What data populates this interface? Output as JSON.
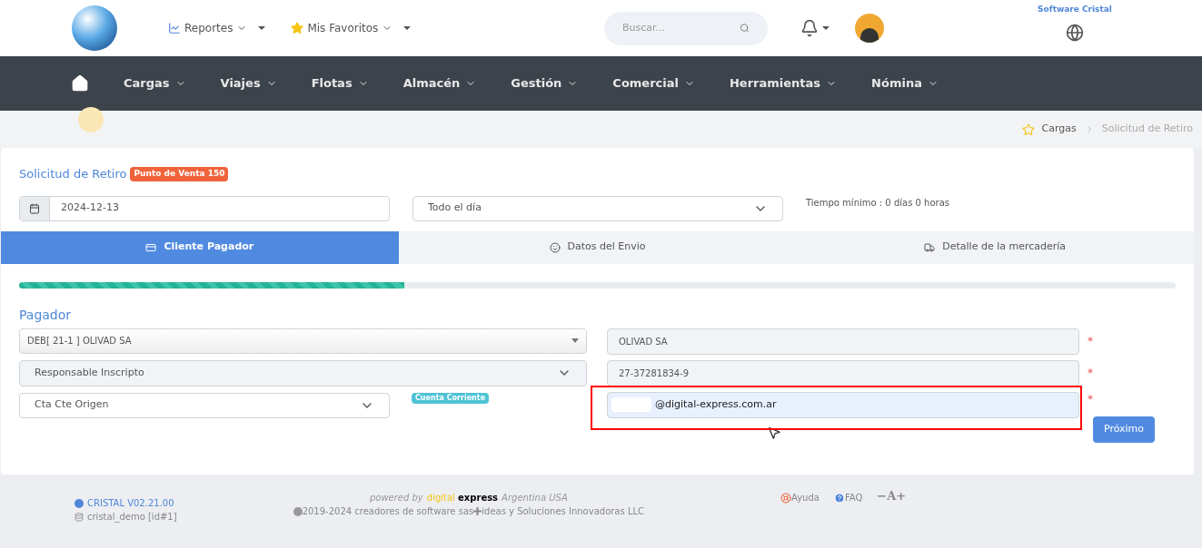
{
  "header": {
    "menus": [
      {
        "label": "Reportes",
        "kind": "chart"
      },
      {
        "label": "Mis Favoritos",
        "kind": "star"
      }
    ],
    "search": {
      "placeholder": "Buscar..."
    },
    "corner_text": "Software Cristal"
  },
  "nav": {
    "items": [
      {
        "label": "Cargas"
      },
      {
        "label": "Viajes"
      },
      {
        "label": "Flotas"
      },
      {
        "label": "Almacén"
      },
      {
        "label": "Gestión"
      },
      {
        "label": "Comercial"
      },
      {
        "label": "Herramientas"
      },
      {
        "label": "Nómina"
      }
    ]
  },
  "breadcrumb": [
    "Cargas",
    "Solicitud de Retiro"
  ],
  "form": {
    "title": "Solicitud de Retiro",
    "badge": "Punto de Venta 150",
    "date": "2024-12-13",
    "time_option": "Todo el día",
    "min_time": "Tiempo mínimo : 0 días 0 horas",
    "tabs": [
      {
        "label": "Cliente Pagador",
        "selected": true,
        "kind": "card"
      },
      {
        "label": "Datos del Envio",
        "selected": false,
        "kind": "face"
      },
      {
        "label": "Detalle de la mercadería",
        "selected": false,
        "kind": "truck"
      }
    ],
    "progress": {
      "level": 0.333
    },
    "section": "Pagador",
    "client": "DEB[ 21-1 ] OLIVAD SA",
    "tax_condition": "Responsable Inscripto",
    "account": "Cta Cte Origen",
    "account_tag": "Cuenta Corriente",
    "name": "OLIVAD SA",
    "cuit": "27-37281834-9",
    "email": "@digital-express.com.ar",
    "required_mark": "*",
    "next_button": "Próximo"
  },
  "footer": {
    "version": "CRISTAL V02.21.00",
    "db": "cristal_demo [id#1]",
    "powered_by": "powered by",
    "brand_1": "digital",
    "brand_2": "express",
    "region": "Argentina USA",
    "copyright": "2019-2024 creadores de software sas",
    "copyright_2": "ideas y Soluciones Innovadoras LLC",
    "help": "Ayuda",
    "faq": "FAQ",
    "font_minus": "−",
    "font_a": "A",
    "font_plus": "+"
  }
}
